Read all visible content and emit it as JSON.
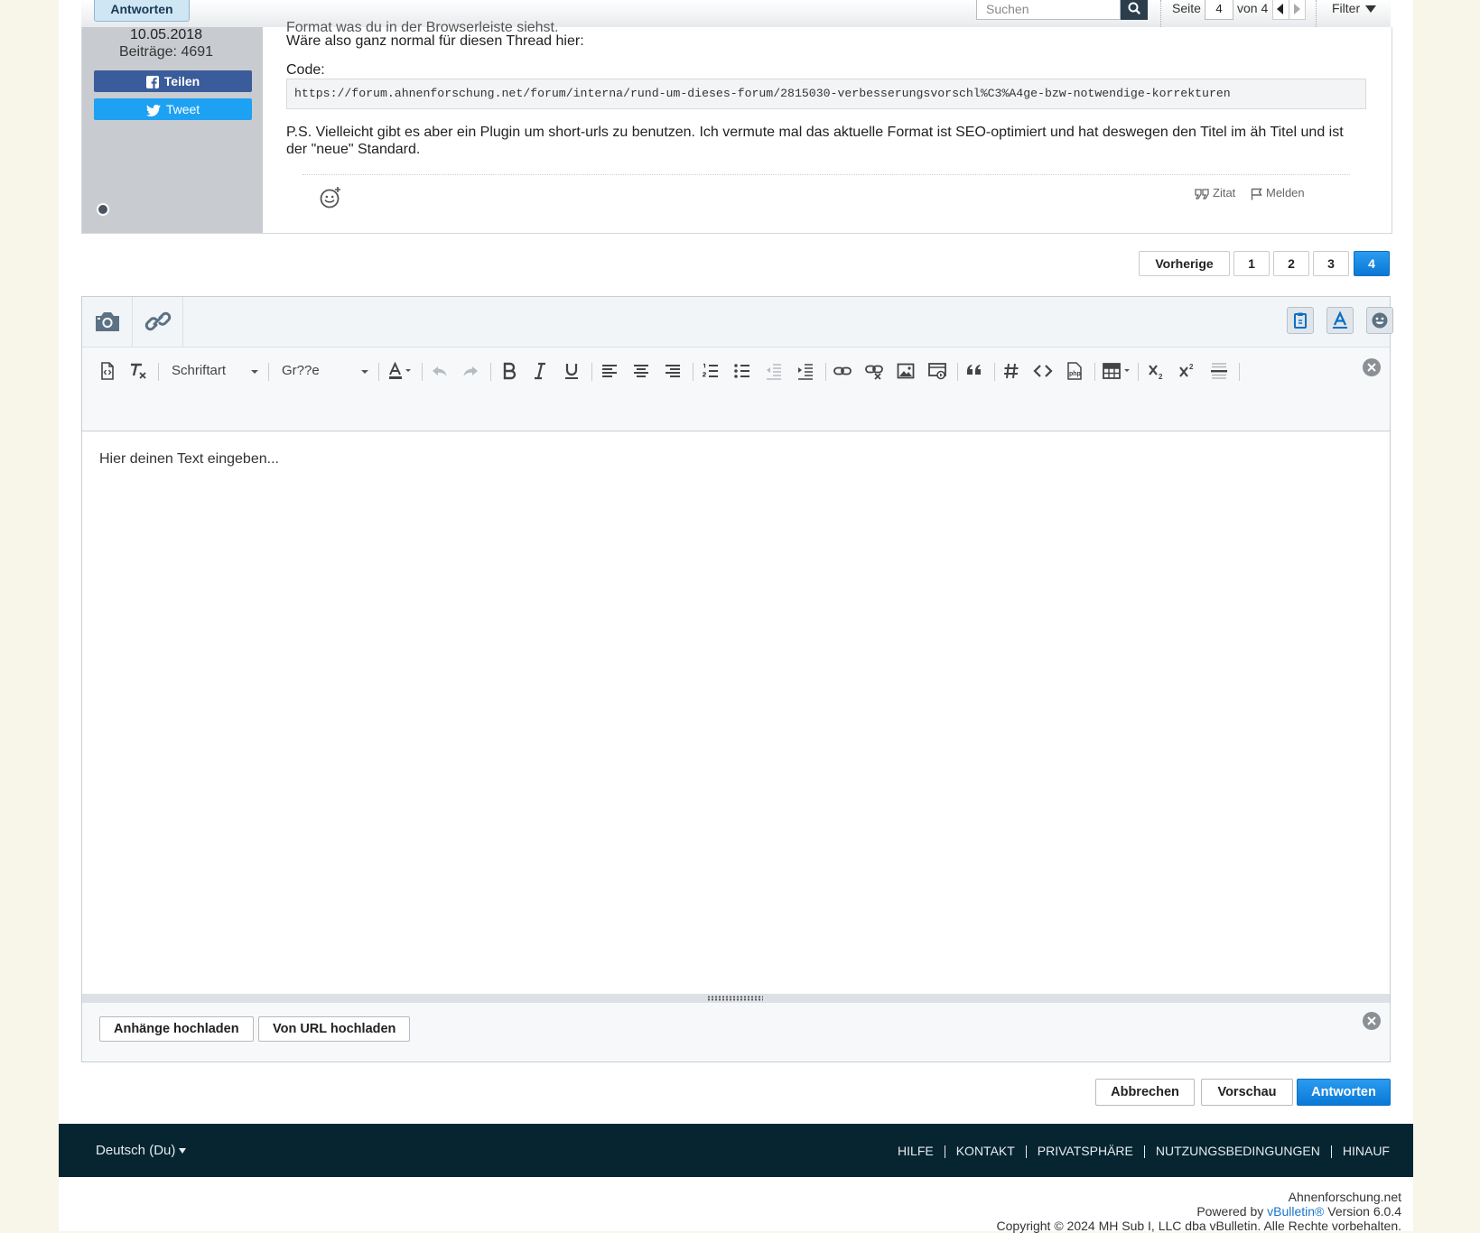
{
  "thread_bar": {
    "reply_label": "Antworten",
    "search_placeholder": "Suchen",
    "page_label": "Seite",
    "page_current": "4",
    "page_of": "von 4",
    "filter_label": "Filter"
  },
  "post": {
    "cut_line": "Format was du in der Browserleiste siehst.",
    "join_date": "10.05.2018",
    "post_count": "Beiträge: 4691",
    "share_facebook": "Teilen",
    "share_twitter": "Tweet",
    "text_line": "Wäre also ganz normal für diesen Thread hier:",
    "code_label": "Code:",
    "code": "https://forum.ahnenforschung.net/forum/interna/rund-um-dieses-forum/2815030-verbesserungsvorschl%C3%A4ge-bzw-notwendige-korrekturen",
    "ps_text": "P.S. Vielleicht gibt es aber ein Plugin um short-urls zu benutzen. Ich vermute mal das aktuelle Format ist SEO-optimiert und hat deswegen den Titel im äh Titel und ist der \"neue\" Standard.",
    "quote_label": "Zitat",
    "report_label": "Melden"
  },
  "pagination": {
    "prev_label": "Vorherige",
    "pages": [
      "1",
      "2",
      "3",
      "4"
    ],
    "active_page": "4"
  },
  "editor": {
    "font_combo": "Schriftart",
    "size_combo": "Gr??e",
    "placeholder": "Hier deinen Text eingeben...",
    "upload_attachments": "Anhänge hochladen",
    "upload_url": "Von URL hochladen"
  },
  "form": {
    "cancel_label": "Abbrechen",
    "preview_label": "Vorschau",
    "submit_label": "Antworten"
  },
  "footer": {
    "language": "Deutsch (Du)",
    "links": [
      "HILFE",
      "KONTAKT",
      "PRIVATSPHÄRE",
      "NUTZUNGSBEDINGUNGEN",
      "HINAUF"
    ],
    "site_name": "Ahnenforschung.net",
    "powered_by": "Powered by",
    "vbulletin": "vBulletin®",
    "version": "Version 6.0.4",
    "copyright": "Copyright © 2024 MH Sub I, LLC dba vBulletin. Alle Rechte vorbehalten."
  },
  "colors": {
    "page_background": "#f8f6e8",
    "accent_blue": "#0a78d6",
    "footer_background": "#062531",
    "sidebar_gray": "#c8ccd0",
    "facebook_blue": "#3b5c9a",
    "twitter_blue": "#1da1f2"
  }
}
